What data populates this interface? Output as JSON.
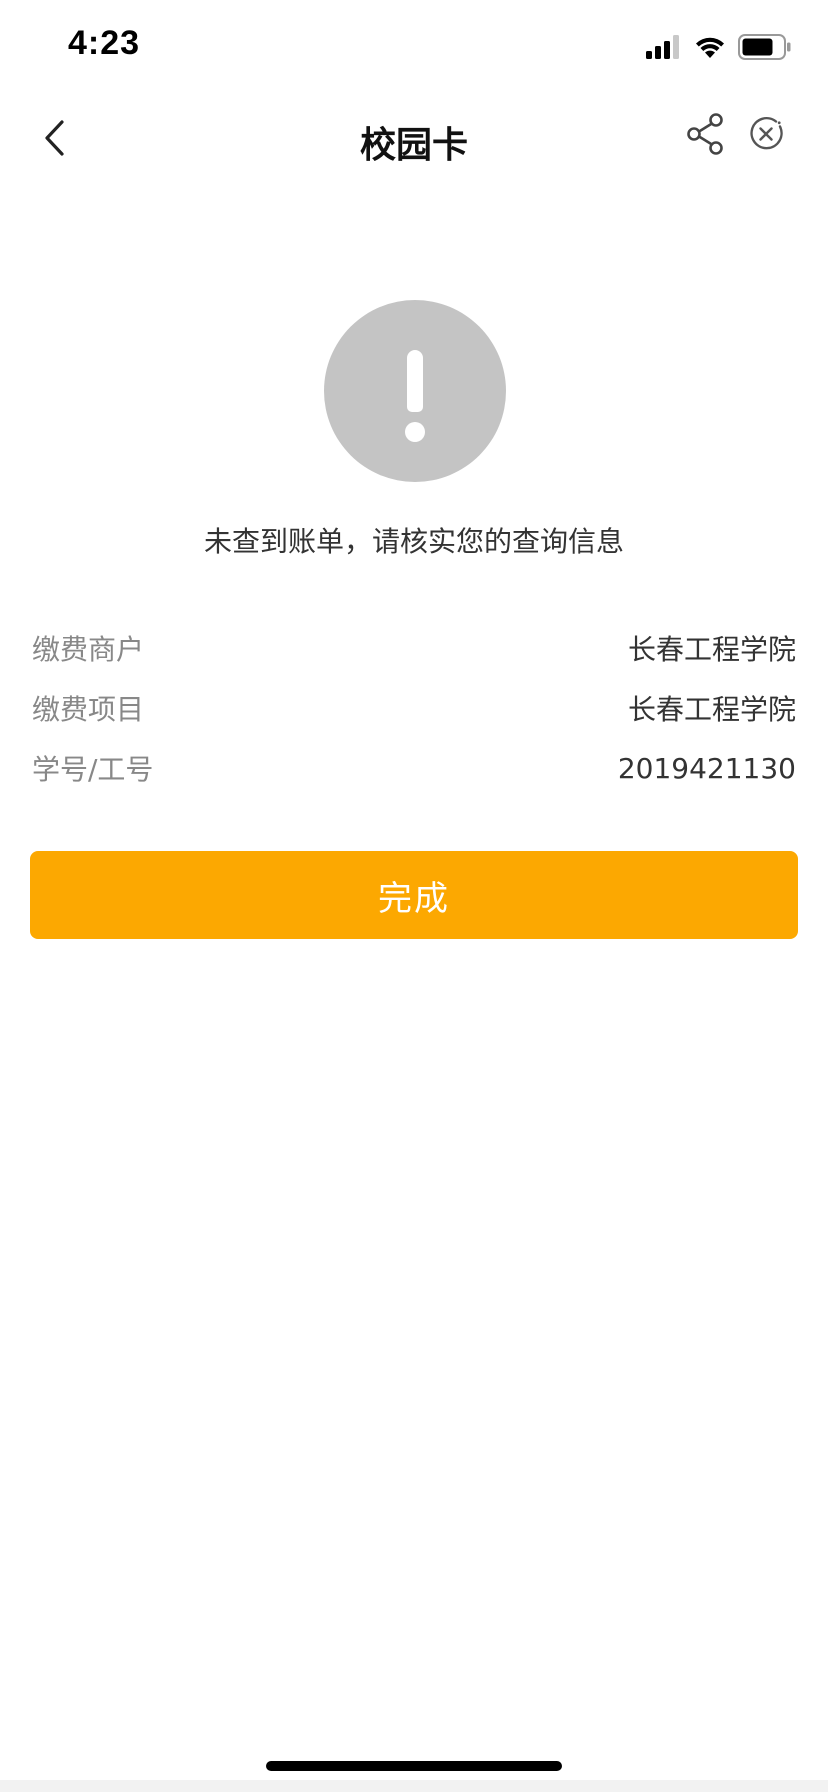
{
  "status_bar": {
    "time": "4:23",
    "icons": [
      "cellular-signal-icon",
      "wifi-icon",
      "battery-icon"
    ]
  },
  "nav": {
    "title": "校园卡",
    "back_icon": "chevron-left-icon",
    "share_icon": "share-icon",
    "close_icon": "close-circle-icon"
  },
  "alert": {
    "icon": "exclamation-circle-icon",
    "message": "未查到账单，请核实您的查询信息"
  },
  "info": [
    {
      "label": "缴费商户",
      "value": "长春工程学院"
    },
    {
      "label": "缴费项目",
      "value": "长春工程学院"
    },
    {
      "label": "学号/工号",
      "value": "2019421130"
    }
  ],
  "actions": {
    "done_label": "完成"
  },
  "colors": {
    "accent": "#fca801",
    "alert_circle": "#c4c4c4",
    "label_text": "#888888",
    "value_text": "#333333"
  }
}
